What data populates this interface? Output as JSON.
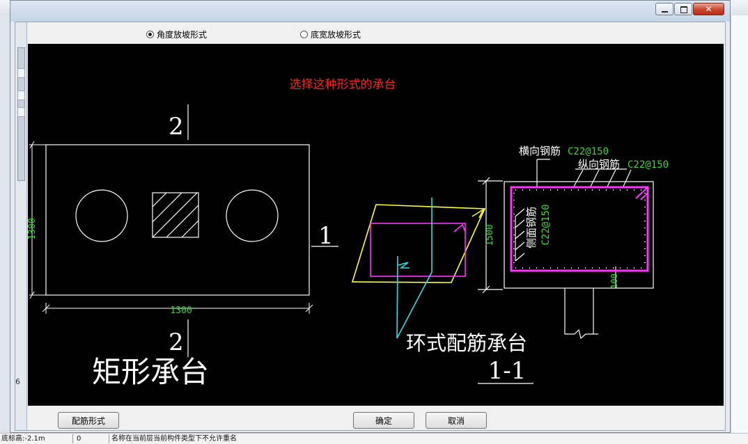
{
  "dialog": {
    "close_glyph": "✕",
    "radio_options": [
      {
        "label": "角度放坡形式",
        "selected": true
      },
      {
        "label": "底宽放坡形式",
        "selected": false
      }
    ],
    "sidebar_number": "6",
    "buttons": {
      "rebar_form": "配筋形式",
      "ok": "确定",
      "cancel": "取消"
    }
  },
  "drawing": {
    "prompt": "选择这种形式的承台",
    "plan": {
      "section_mark_top": "2",
      "section_mark_bottom": "2",
      "section_mark_side": "1",
      "dim_vertical": "1300",
      "dim_horizontal": "1300",
      "caption": "矩形承台"
    },
    "ring_caption": "环式配筋承台",
    "section": {
      "title": "1-1",
      "transverse_label": "横向钢筋",
      "transverse_spec": "C22@150",
      "longitudinal_label": "纵向钢筋",
      "longitudinal_spec": "C22@150",
      "side_label": "侧面钢筋",
      "side_spec": "C22@150",
      "height_dim": "1500",
      "embed_dim": "100"
    },
    "colors": {
      "background": "#000000",
      "outline": "#ffffff",
      "dimension": "#33dd33",
      "prompt": "#ff2222",
      "magenta": "#ff33ff",
      "cyan": "#33dddd",
      "yellow": "#ffff33"
    }
  },
  "status": {
    "elevation": "底标高:-2.1m",
    "code": "0",
    "message": "名称在当前层当前构件类型下不允许重名"
  }
}
